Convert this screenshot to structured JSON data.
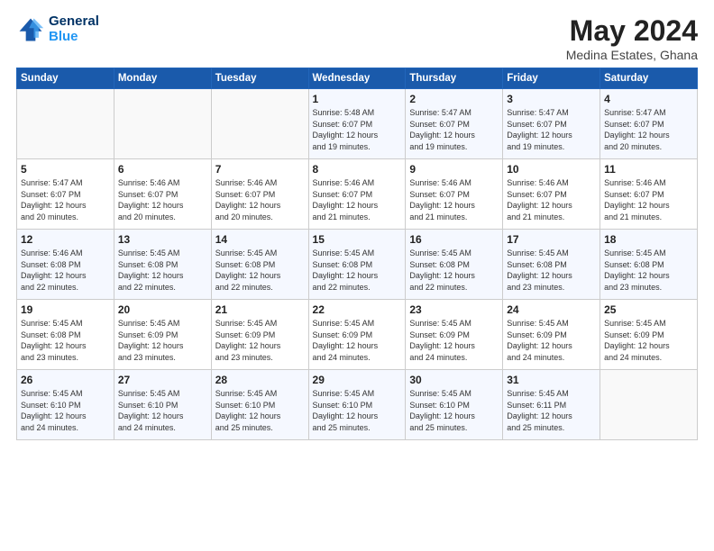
{
  "header": {
    "logo_line1": "General",
    "logo_line2": "Blue",
    "month_year": "May 2024",
    "location": "Medina Estates, Ghana"
  },
  "days_of_week": [
    "Sunday",
    "Monday",
    "Tuesday",
    "Wednesday",
    "Thursday",
    "Friday",
    "Saturday"
  ],
  "weeks": [
    [
      {
        "day": "",
        "info": ""
      },
      {
        "day": "",
        "info": ""
      },
      {
        "day": "",
        "info": ""
      },
      {
        "day": "1",
        "info": "Sunrise: 5:48 AM\nSunset: 6:07 PM\nDaylight: 12 hours\nand 19 minutes."
      },
      {
        "day": "2",
        "info": "Sunrise: 5:47 AM\nSunset: 6:07 PM\nDaylight: 12 hours\nand 19 minutes."
      },
      {
        "day": "3",
        "info": "Sunrise: 5:47 AM\nSunset: 6:07 PM\nDaylight: 12 hours\nand 19 minutes."
      },
      {
        "day": "4",
        "info": "Sunrise: 5:47 AM\nSunset: 6:07 PM\nDaylight: 12 hours\nand 20 minutes."
      }
    ],
    [
      {
        "day": "5",
        "info": "Sunrise: 5:47 AM\nSunset: 6:07 PM\nDaylight: 12 hours\nand 20 minutes."
      },
      {
        "day": "6",
        "info": "Sunrise: 5:46 AM\nSunset: 6:07 PM\nDaylight: 12 hours\nand 20 minutes."
      },
      {
        "day": "7",
        "info": "Sunrise: 5:46 AM\nSunset: 6:07 PM\nDaylight: 12 hours\nand 20 minutes."
      },
      {
        "day": "8",
        "info": "Sunrise: 5:46 AM\nSunset: 6:07 PM\nDaylight: 12 hours\nand 21 minutes."
      },
      {
        "day": "9",
        "info": "Sunrise: 5:46 AM\nSunset: 6:07 PM\nDaylight: 12 hours\nand 21 minutes."
      },
      {
        "day": "10",
        "info": "Sunrise: 5:46 AM\nSunset: 6:07 PM\nDaylight: 12 hours\nand 21 minutes."
      },
      {
        "day": "11",
        "info": "Sunrise: 5:46 AM\nSunset: 6:07 PM\nDaylight: 12 hours\nand 21 minutes."
      }
    ],
    [
      {
        "day": "12",
        "info": "Sunrise: 5:46 AM\nSunset: 6:08 PM\nDaylight: 12 hours\nand 22 minutes."
      },
      {
        "day": "13",
        "info": "Sunrise: 5:45 AM\nSunset: 6:08 PM\nDaylight: 12 hours\nand 22 minutes."
      },
      {
        "day": "14",
        "info": "Sunrise: 5:45 AM\nSunset: 6:08 PM\nDaylight: 12 hours\nand 22 minutes."
      },
      {
        "day": "15",
        "info": "Sunrise: 5:45 AM\nSunset: 6:08 PM\nDaylight: 12 hours\nand 22 minutes."
      },
      {
        "day": "16",
        "info": "Sunrise: 5:45 AM\nSunset: 6:08 PM\nDaylight: 12 hours\nand 22 minutes."
      },
      {
        "day": "17",
        "info": "Sunrise: 5:45 AM\nSunset: 6:08 PM\nDaylight: 12 hours\nand 23 minutes."
      },
      {
        "day": "18",
        "info": "Sunrise: 5:45 AM\nSunset: 6:08 PM\nDaylight: 12 hours\nand 23 minutes."
      }
    ],
    [
      {
        "day": "19",
        "info": "Sunrise: 5:45 AM\nSunset: 6:08 PM\nDaylight: 12 hours\nand 23 minutes."
      },
      {
        "day": "20",
        "info": "Sunrise: 5:45 AM\nSunset: 6:09 PM\nDaylight: 12 hours\nand 23 minutes."
      },
      {
        "day": "21",
        "info": "Sunrise: 5:45 AM\nSunset: 6:09 PM\nDaylight: 12 hours\nand 23 minutes."
      },
      {
        "day": "22",
        "info": "Sunrise: 5:45 AM\nSunset: 6:09 PM\nDaylight: 12 hours\nand 24 minutes."
      },
      {
        "day": "23",
        "info": "Sunrise: 5:45 AM\nSunset: 6:09 PM\nDaylight: 12 hours\nand 24 minutes."
      },
      {
        "day": "24",
        "info": "Sunrise: 5:45 AM\nSunset: 6:09 PM\nDaylight: 12 hours\nand 24 minutes."
      },
      {
        "day": "25",
        "info": "Sunrise: 5:45 AM\nSunset: 6:09 PM\nDaylight: 12 hours\nand 24 minutes."
      }
    ],
    [
      {
        "day": "26",
        "info": "Sunrise: 5:45 AM\nSunset: 6:10 PM\nDaylight: 12 hours\nand 24 minutes."
      },
      {
        "day": "27",
        "info": "Sunrise: 5:45 AM\nSunset: 6:10 PM\nDaylight: 12 hours\nand 24 minutes."
      },
      {
        "day": "28",
        "info": "Sunrise: 5:45 AM\nSunset: 6:10 PM\nDaylight: 12 hours\nand 25 minutes."
      },
      {
        "day": "29",
        "info": "Sunrise: 5:45 AM\nSunset: 6:10 PM\nDaylight: 12 hours\nand 25 minutes."
      },
      {
        "day": "30",
        "info": "Sunrise: 5:45 AM\nSunset: 6:10 PM\nDaylight: 12 hours\nand 25 minutes."
      },
      {
        "day": "31",
        "info": "Sunrise: 5:45 AM\nSunset: 6:11 PM\nDaylight: 12 hours\nand 25 minutes."
      },
      {
        "day": "",
        "info": ""
      }
    ]
  ]
}
